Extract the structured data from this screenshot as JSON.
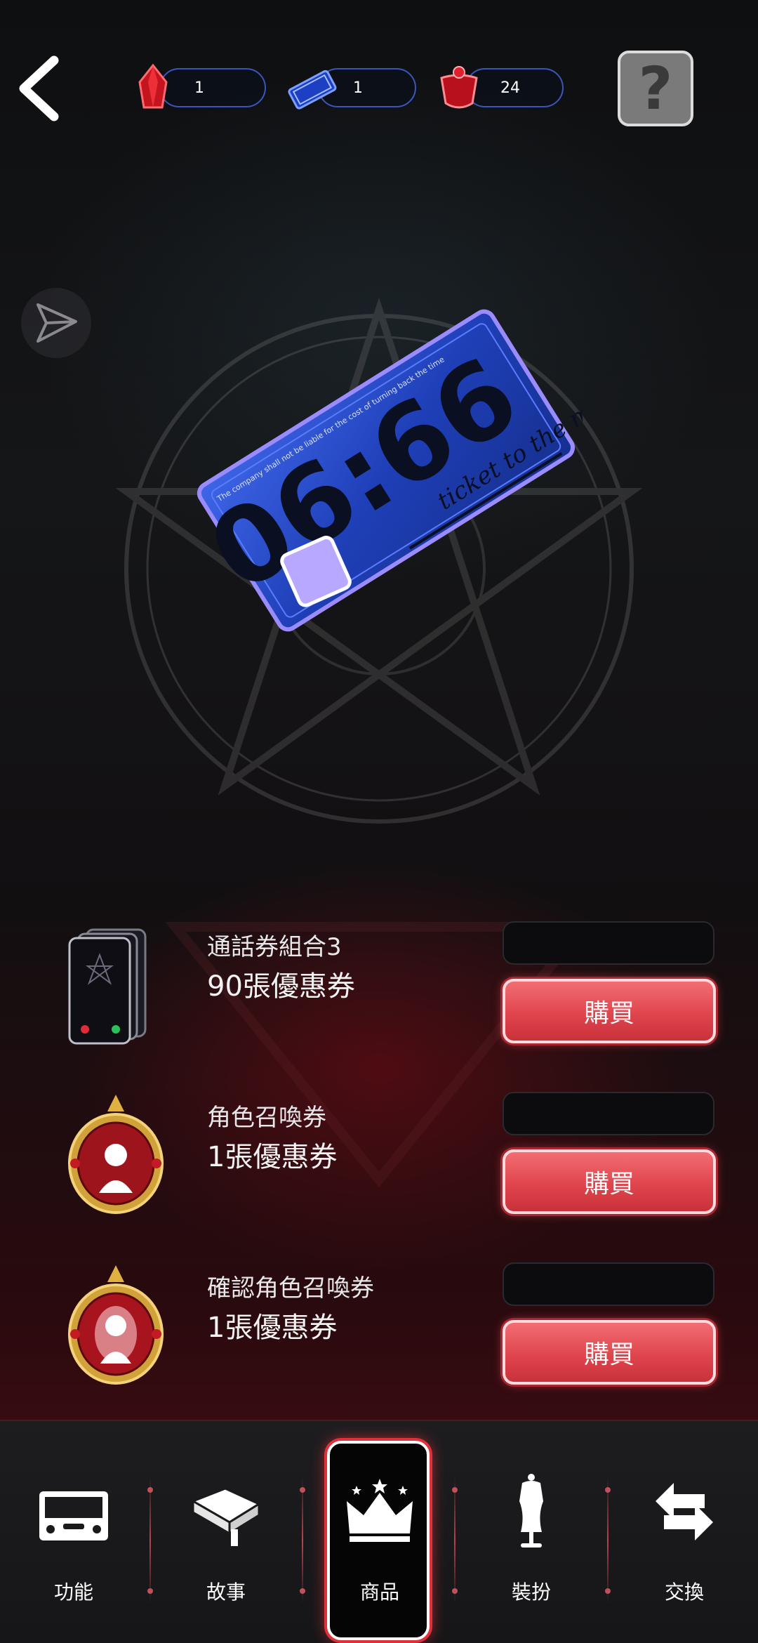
{
  "header": {
    "currencies": [
      {
        "icon": "red-crystal-icon",
        "value": "1"
      },
      {
        "icon": "blue-ticket-icon",
        "value": "1"
      },
      {
        "icon": "red-potion-icon",
        "value": "24"
      }
    ],
    "help_label": "?"
  },
  "hero": {
    "ticket_time": "06:66",
    "ticket_caption": "ticket to the moment",
    "ticket_fineprint": "The company shall not be liable for the cost of turning back the time"
  },
  "shop": {
    "buy_label": "購買",
    "items": [
      {
        "title": "通話券組合3",
        "subtitle": "90張優惠券",
        "price": "",
        "icon": "phone-bundle-icon"
      },
      {
        "title": "角色召喚券",
        "subtitle": "1張優惠券",
        "price": "",
        "icon": "character-summon-icon"
      },
      {
        "title": "確認角色召喚券",
        "subtitle": "1張優惠券",
        "price": "",
        "icon": "confirmed-summon-icon"
      }
    ]
  },
  "nav": {
    "items": [
      {
        "label": "功能",
        "icon": "console-icon"
      },
      {
        "label": "故事",
        "icon": "book-icon"
      },
      {
        "label": "商品",
        "icon": "crown-icon",
        "active": true
      },
      {
        "label": "裝扮",
        "icon": "mannequin-icon"
      },
      {
        "label": "交換",
        "icon": "exchange-arrows-icon"
      }
    ]
  },
  "colors": {
    "buy_button": "#e0454d",
    "currency_border": "#3b56b8",
    "active_glow": "#e0303a",
    "ticket_blue": "#1f3fb8"
  }
}
